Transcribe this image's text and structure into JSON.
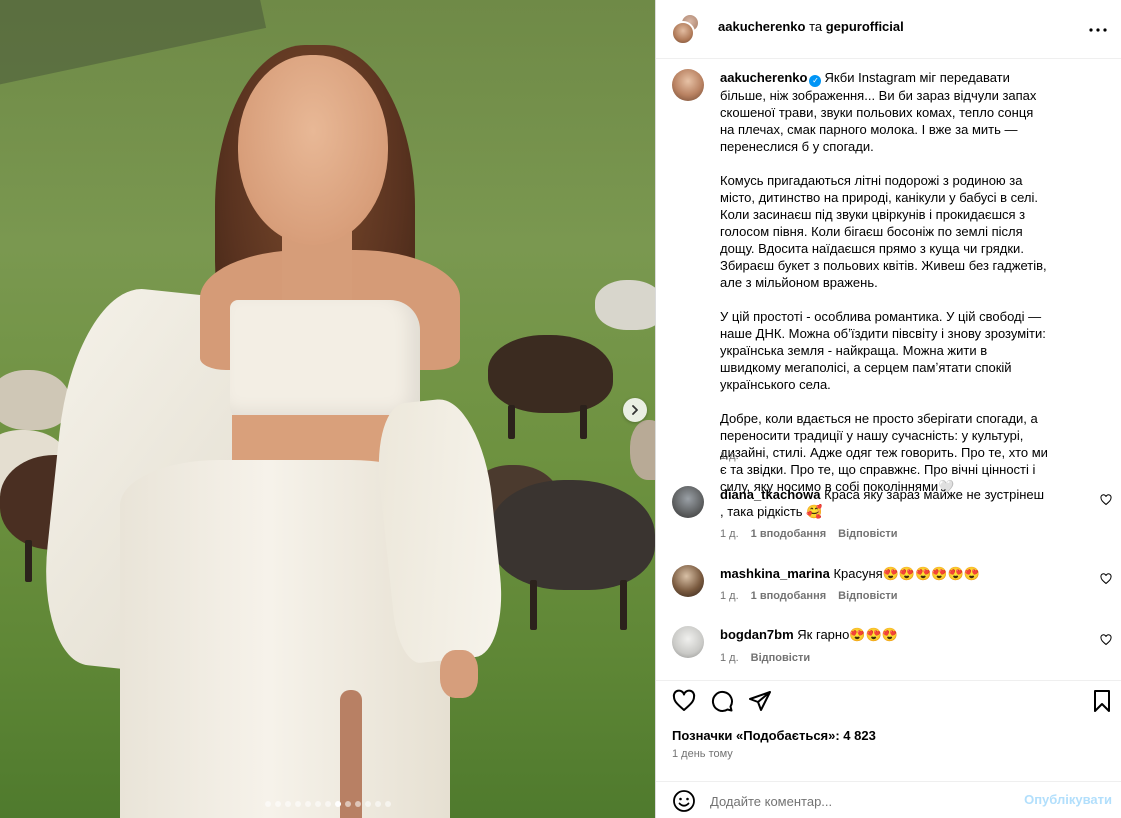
{
  "header": {
    "user1": "aakucherenko",
    "conjunction": "та",
    "user2": "gepurofficial"
  },
  "caption": {
    "username": "aakucherenko",
    "paragraphs": [
      "Якби Instagram міг передавати більше, ніж зображення... Ви би зараз відчули запах скошеної трави, звуки польових комах, тепло сонця на плечах, смак парного молока. І вже за мить — перенеслися б у спогади.",
      "Комусь пригадаються літні подорожі з родиною за місто, дитинство на природі, канікули у бабусі в селі. Коли засинаєш під звуки цвіркунів і прокидаєшся з голосом півня. Коли бігаєш босоніж по землі після дощу. Вдосита наїдаєшся прямо з куща чи грядки. Збираєш букет з польових квітів. Живеш без гаджетів, але з мільйоном вражень.",
      "У цій простоті - особлива романтика. У цій свободі — наше ДНК. Можна обʼїздити півсвіту і знову зрозуміти: українська земля - найкраща. Можна жити в швидкому мегаполісі, а серцем памʼятати спокій українського села.",
      "Добре, коли вдається не просто зберігати спогади, а переносити традиції у нашу сучасність: у культурі, дизайні, стилі. Адже одяг теж говорить. Про те, хто ми є та звідки. Про те, що справжнє. Про вічні цінності і силу, яку носимо в собі поколіннями🤍"
    ],
    "time": "1 д."
  },
  "comments": [
    {
      "username": "diana_tkachowa",
      "text": "Краса яку зараз майже не зустрінеш , така рідкість 🥰",
      "time": "1 д.",
      "likes": "1 вподобання",
      "reply": "Відповісти"
    },
    {
      "username": "mashkina_marina",
      "text": "Красуня😍😍😍😍😍😍",
      "time": "1 д.",
      "likes": "1 вподобання",
      "reply": "Відповісти"
    },
    {
      "username": "bogdan7bm",
      "text": "Як гарно😍😍😍",
      "time": "1 д.",
      "reply": "Відповісти"
    }
  ],
  "footer": {
    "likes_label": "Позначки «Подобається»: 4 823",
    "date": "1 день тому",
    "comment_placeholder": "Додайте коментар...",
    "post_label": "Опублікувати"
  },
  "carousel": {
    "slide_count": 13,
    "active_index": 7
  },
  "colors": {
    "accent": "#0095f6",
    "post_disabled": "#b2dffc",
    "secondary_text": "#737373",
    "border": "#dbdbdb"
  }
}
